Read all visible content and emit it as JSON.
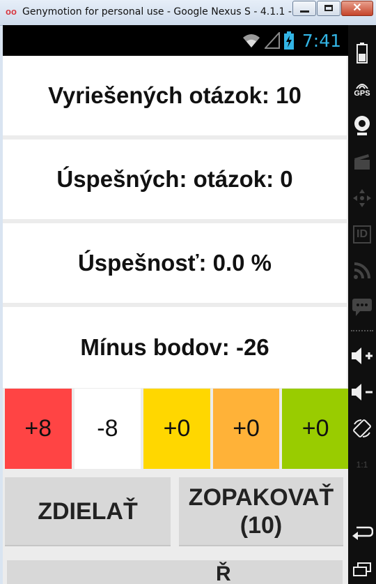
{
  "window": {
    "title": "Genymotion for personal use - Google Nexus S - 4.1.1 - ...",
    "app_icon": "genymotion-logo",
    "controls": [
      "minimize",
      "maximize",
      "close"
    ],
    "close_symbol": "✕"
  },
  "status_bar": {
    "time": "7:41",
    "accent_color": "#33b5e5",
    "icons": [
      "wifi-icon",
      "signal-icon",
      "battery-charging-icon"
    ]
  },
  "stats": [
    {
      "label": "Vyriešených otázok: 10"
    },
    {
      "label": "Úspešných: otázok: 0"
    },
    {
      "label": "Úspešnosť: 0.0 %"
    },
    {
      "label": "Mínus bodov: -26"
    }
  ],
  "scores": [
    {
      "value": "+8",
      "color": "#ff4444"
    },
    {
      "value": "-8",
      "color": "#ffffff"
    },
    {
      "value": "+0",
      "color": "#ffd700"
    },
    {
      "value": "+0",
      "color": "#ffb238"
    },
    {
      "value": "+0",
      "color": "#99cc00"
    }
  ],
  "buttons": {
    "share": "ZDIELAŤ",
    "repeat_line1": "ZOPAKOVAŤ",
    "repeat_line2": "(10)",
    "bottom_partial": "Ř"
  },
  "sidebar": {
    "gps_label": "GPS",
    "id_label": "ID",
    "ratio_label": "1:1",
    "icons": [
      "battery-icon",
      "gps-icon",
      "webcam-icon",
      "video-icon",
      "dpad-icon",
      "id-icon",
      "rss-icon",
      "sms-icon",
      "volume-up-icon",
      "volume-down-icon",
      "rotate-icon",
      "scale-icon",
      "back-icon",
      "recent-apps-icon"
    ]
  }
}
